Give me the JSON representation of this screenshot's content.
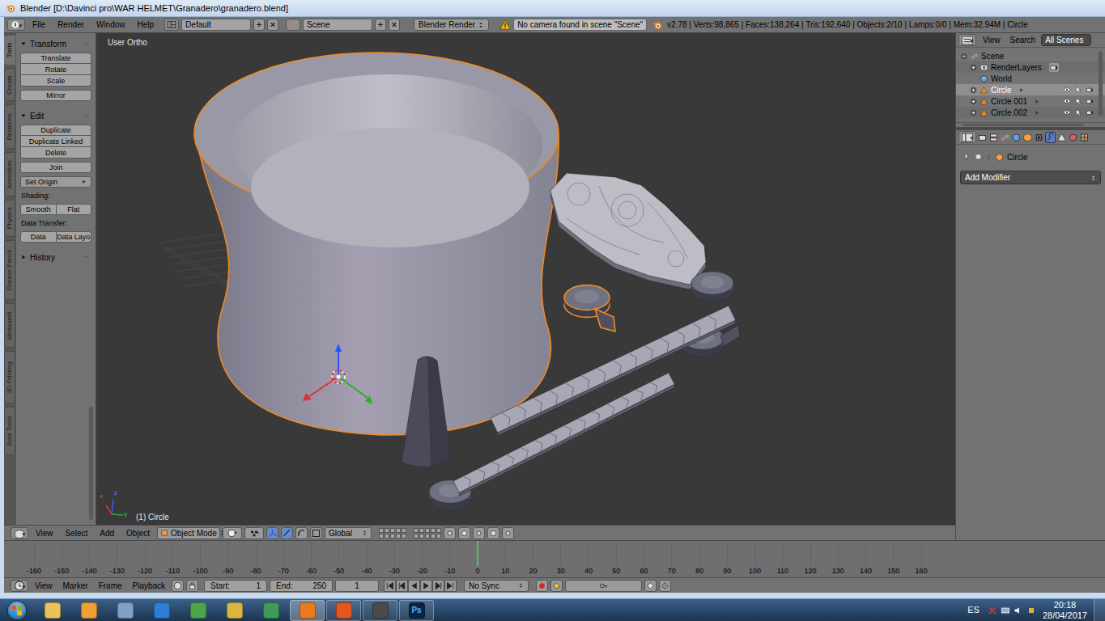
{
  "window": {
    "title": "Blender [D:\\Davinci pro\\WAR HELMET\\Granadero\\granadero.blend]"
  },
  "info_header": {
    "menus": [
      "File",
      "Render",
      "Window",
      "Help"
    ],
    "layout": "Default",
    "scene": "Scene",
    "engine": "Blender Render",
    "warning": "No camera found in scene \"Scene\"",
    "stats": "v2.78 | Verts:98,865 | Faces:138,264 | Tris:192,640 | Objects:2/10 | Lamps:0/0 | Mem:32.94M | Circle"
  },
  "tool_tabs": [
    {
      "label": "Tools",
      "selected": true
    },
    {
      "label": "Create",
      "selected": false
    },
    {
      "label": "Relations",
      "selected": false
    },
    {
      "label": "Animation",
      "selected": false
    },
    {
      "label": "Physics",
      "selected": false
    },
    {
      "label": "Grease Pencil",
      "selected": false
    },
    {
      "label": "Measureit",
      "selected": false
    },
    {
      "label": "3D Printing",
      "selected": false
    },
    {
      "label": "Bool Tools",
      "selected": false
    }
  ],
  "tool_shelf": {
    "panels": [
      {
        "title": "Transform",
        "expanded": true,
        "rows": [
          {
            "kind": "column",
            "items": [
              "Translate",
              "Rotate",
              "Scale"
            ]
          },
          {
            "kind": "column",
            "items": [
              "Mirror"
            ]
          }
        ]
      },
      {
        "title": "Edit",
        "expanded": true,
        "rows": [
          {
            "kind": "column",
            "items": [
              "Duplicate",
              "Duplicate Linked",
              "Delete"
            ]
          },
          {
            "kind": "column",
            "items": [
              "Join"
            ]
          },
          {
            "kind": "dropdown",
            "items": [
              "Set Origin"
            ]
          },
          {
            "kind": "label",
            "items": [
              "Shading:"
            ]
          },
          {
            "kind": "pair",
            "items": [
              "Smooth",
              "Flat"
            ]
          },
          {
            "kind": "label",
            "items": [
              "Data Transfer:"
            ]
          },
          {
            "kind": "pair",
            "items": [
              "Data",
              "Data Layo"
            ]
          }
        ]
      },
      {
        "title": "History",
        "expanded": false,
        "rows": []
      }
    ]
  },
  "viewport": {
    "view_label": "User Ortho",
    "object_label": "(1) Circle",
    "axis_labels": [
      "x",
      "y",
      "z"
    ],
    "objects": [
      {
        "selected": true
      },
      {
        "selected": false
      },
      {
        "selected": true
      },
      {
        "selected": false
      },
      {
        "selected": false
      },
      {
        "selected": false
      },
      {
        "selected": false
      },
      {
        "selected": false
      },
      {
        "selected": false
      }
    ]
  },
  "outliner": {
    "view": "View",
    "search": "Search",
    "filter": "All Scenes",
    "items": [
      {
        "label": "Scene",
        "depth": 0,
        "kind": "scene",
        "expanded": true,
        "selected": false
      },
      {
        "label": "RenderLayers",
        "depth": 1,
        "kind": "layers",
        "expanded": false,
        "selected": false
      },
      {
        "label": "World",
        "depth": 1,
        "kind": "world",
        "expanded": false,
        "selected": false
      },
      {
        "label": "Circle",
        "depth": 1,
        "kind": "object",
        "expanded": false,
        "selected": true
      },
      {
        "label": "Circle.001",
        "depth": 1,
        "kind": "object",
        "expanded": false,
        "selected": false
      },
      {
        "label": "Circle.002",
        "depth": 1,
        "kind": "object",
        "expanded": false,
        "selected": false
      }
    ]
  },
  "properties": {
    "tabs": [
      {
        "selected": false
      },
      {
        "selected": false
      },
      {
        "selected": false
      },
      {
        "selected": false
      },
      {
        "selected": false
      },
      {
        "selected": false
      },
      {
        "selected": true
      },
      {
        "selected": false
      },
      {
        "selected": false
      },
      {
        "selected": false
      }
    ],
    "breadcrumb": "Circle",
    "add_modifier": "Add Modifier"
  },
  "viewport_header": {
    "menus": [
      "View",
      "Select",
      "Add",
      "Object"
    ],
    "mode": "Object Mode",
    "orientation": "Global"
  },
  "timeline": {
    "ticks": [
      "-160",
      "-150",
      "-140",
      "-130",
      "-120",
      "-110",
      "-100",
      "-90",
      "-80",
      "-70",
      "-60",
      "-50",
      "-40",
      "-30",
      "-20",
      "-10",
      "0",
      "10",
      "20",
      "30",
      "40",
      "50",
      "60",
      "70",
      "80",
      "90",
      "100",
      "110",
      "120",
      "130",
      "140",
      "150",
      "160"
    ],
    "current_frame": 0
  },
  "timeline_header": {
    "menus": [
      "View",
      "Marker",
      "Frame",
      "Playback"
    ],
    "start_label": "Start:",
    "start": "1",
    "end_label": "End:",
    "end": "250",
    "current": "1",
    "sync": "No Sync"
  },
  "taskbar": {
    "apps": [
      {
        "color": "#e9c25a",
        "running": false,
        "selected": false
      },
      {
        "color": "#f0a030",
        "running": false,
        "selected": false
      },
      {
        "color": "#7fa1c4",
        "running": false,
        "selected": false
      },
      {
        "color": "#2d7fd3",
        "running": false,
        "selected": false
      },
      {
        "color": "#4aa64a",
        "running": false,
        "selected": false
      },
      {
        "color": "#d8b640",
        "running": false,
        "selected": false
      },
      {
        "color": "#3f9a55",
        "running": false,
        "selected": false
      },
      {
        "color": "#ea7a1c",
        "running": true,
        "selected": true
      },
      {
        "color": "#e2571e",
        "running": true,
        "selected": false
      },
      {
        "color": "#4b4b4b",
        "running": true,
        "selected": false
      },
      {
        "color": "#0b2540",
        "running": true,
        "selected": false,
        "label": "Ps"
      }
    ],
    "language": "ES",
    "time": "20:18",
    "date": "28/04/2017"
  }
}
